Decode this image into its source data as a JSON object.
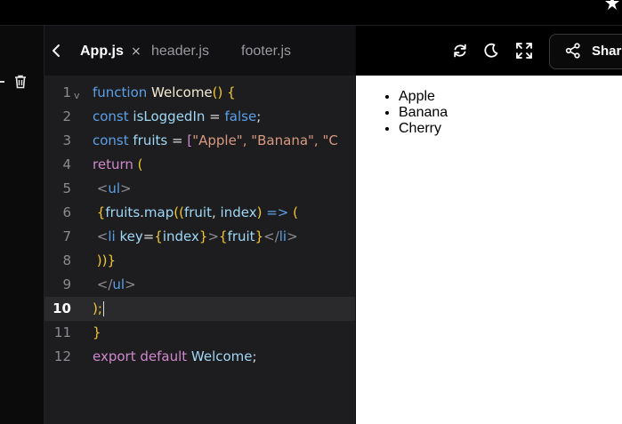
{
  "tabs": [
    {
      "label": "App.js",
      "active": true
    },
    {
      "label": "header.js",
      "active": false
    },
    {
      "label": "footer.js",
      "active": false
    }
  ],
  "tab_close_glyph": "×",
  "share_label": "Shar",
  "icons": [
    "trash-icon",
    "chevron-left-icon",
    "refresh-icon",
    "moon-icon",
    "fullscreen-icon",
    "share-icon",
    "star-icon"
  ],
  "colors": {
    "keyword": "#5aa0e8",
    "function_name": "#f2ead2",
    "brace": "#f1c830",
    "identifier": "#9fd7f5",
    "operator": "#d9d9d9",
    "string": "#d79a80",
    "tag": "#8c8c92",
    "jsx_return": "#d088cc"
  },
  "code_lines": [
    {
      "n": "1",
      "fold": true,
      "tokens": [
        [
          "function ",
          "keyword"
        ],
        [
          "Welcome",
          "function_name"
        ],
        [
          "() {",
          "brace"
        ]
      ]
    },
    {
      "n": "2",
      "tokens": [
        [
          "const ",
          "keyword"
        ],
        [
          "isLoggedIn",
          "identifier"
        ],
        [
          " = ",
          "operator"
        ],
        [
          "false",
          "keyword"
        ],
        [
          ";",
          "operator"
        ]
      ]
    },
    {
      "n": "3",
      "tokens": [
        [
          "const ",
          "keyword"
        ],
        [
          "fruits",
          "identifier"
        ],
        [
          " = ",
          "operator"
        ],
        [
          "[",
          "jsx_return"
        ],
        [
          "\"Apple\", \"Banana\", \"C",
          "string"
        ]
      ]
    },
    {
      "n": "4",
      "tokens": [
        [
          "return ",
          "jsx_return"
        ],
        [
          "(",
          "brace"
        ]
      ]
    },
    {
      "n": "5",
      "tokens": [
        [
          " <",
          "tag"
        ],
        [
          "ul",
          "keyword"
        ],
        [
          ">",
          "tag"
        ]
      ]
    },
    {
      "n": "6",
      "tokens": [
        [
          " {",
          "brace"
        ],
        [
          "fruits",
          "identifier"
        ],
        [
          ".",
          "operator"
        ],
        [
          "map",
          "identifier"
        ],
        [
          "((",
          "brace"
        ],
        [
          "fruit",
          "identifier"
        ],
        [
          ", ",
          "operator"
        ],
        [
          "index",
          "identifier"
        ],
        [
          ")",
          "brace"
        ],
        [
          " => ",
          "keyword"
        ],
        [
          "(",
          "brace"
        ]
      ]
    },
    {
      "n": "7",
      "tokens": [
        [
          " <",
          "tag"
        ],
        [
          "li ",
          "keyword"
        ],
        [
          "key",
          "identifier"
        ],
        [
          "=",
          "operator"
        ],
        [
          "{",
          "brace"
        ],
        [
          "index",
          "identifier"
        ],
        [
          "}",
          "brace"
        ],
        [
          ">",
          "tag"
        ],
        [
          "{",
          "brace"
        ],
        [
          "fruit",
          "identifier"
        ],
        [
          "}",
          "brace"
        ],
        [
          "</",
          "tag"
        ],
        [
          "li",
          "keyword"
        ],
        [
          ">",
          "tag"
        ]
      ]
    },
    {
      "n": "8",
      "tokens": [
        [
          " ))}",
          "brace"
        ]
      ]
    },
    {
      "n": "9",
      "tokens": [
        [
          " </",
          "tag"
        ],
        [
          "ul",
          "keyword"
        ],
        [
          ">",
          "tag"
        ]
      ]
    },
    {
      "n": "10",
      "current": true,
      "tokens": [
        [
          ");",
          "brace"
        ]
      ]
    },
    {
      "n": "11",
      "tokens": [
        [
          "}",
          "brace"
        ]
      ]
    },
    {
      "n": "12",
      "tokens": [
        [
          "export default ",
          "jsx_return"
        ],
        [
          "Welcome",
          "identifier"
        ],
        [
          ";",
          "operator"
        ]
      ]
    }
  ],
  "preview_items": [
    "Apple",
    "Banana",
    "Cherry"
  ]
}
